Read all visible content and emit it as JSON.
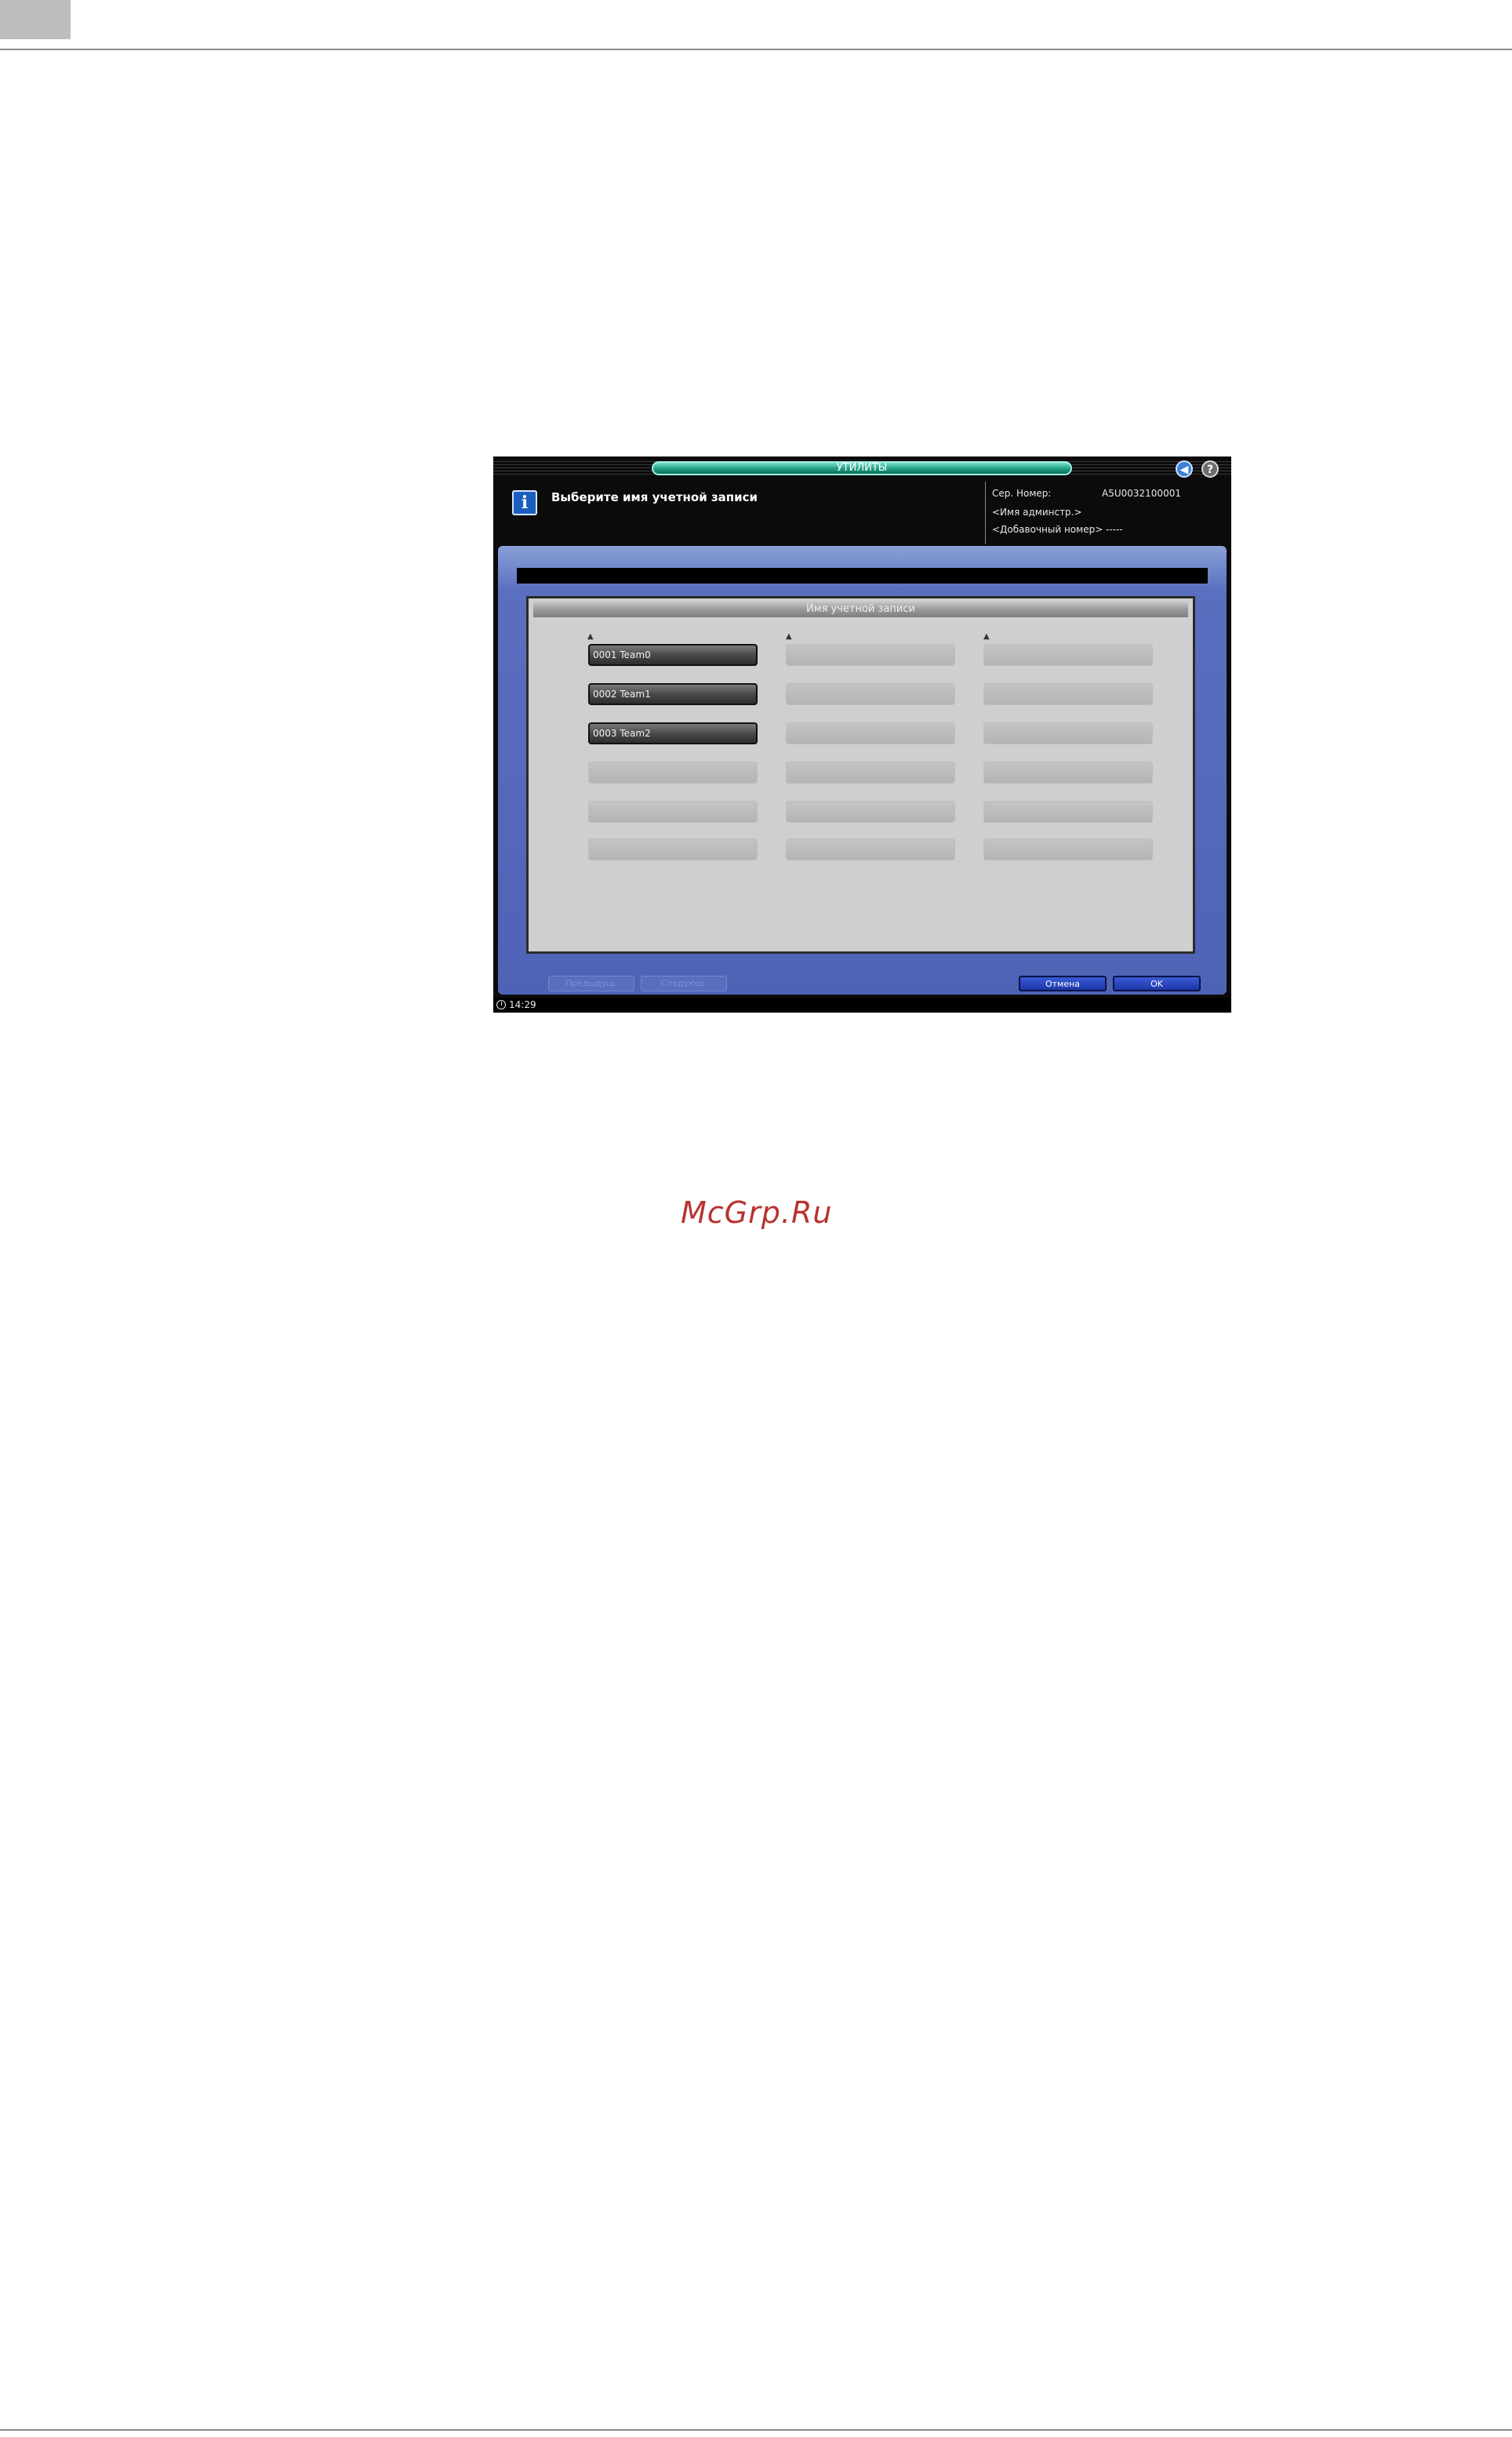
{
  "screen": {
    "title": "УТИЛИТЫ",
    "message": "Выберите имя учетной записи",
    "info": {
      "serial_label": "Сер. Номер:",
      "serial_value": "A5U0032100001",
      "admin_label": "<Имя админстр.>",
      "ext_label": "<Добавочный номер> -----"
    },
    "list_header": "Имя учетной записи",
    "accounts": [
      {
        "label": "0001 Team0"
      },
      {
        "label": "0002 Team1"
      },
      {
        "label": "0003 Team2"
      }
    ],
    "nav": {
      "prev_label": "Предыдущ.",
      "next_label": "Следующ.",
      "cancel_label": "Отмена",
      "ok_label": "OK"
    },
    "time": "14:29"
  },
  "watermark": "McGrp.Ru",
  "icons": {
    "info": "info-icon",
    "sound": "speaker-icon",
    "help": "help-icon",
    "clock": "clock-icon"
  },
  "colors": {
    "frame_blue": "#4f63b6",
    "title_teal": "#1f9d84",
    "watermark_red": "#b8322f"
  }
}
